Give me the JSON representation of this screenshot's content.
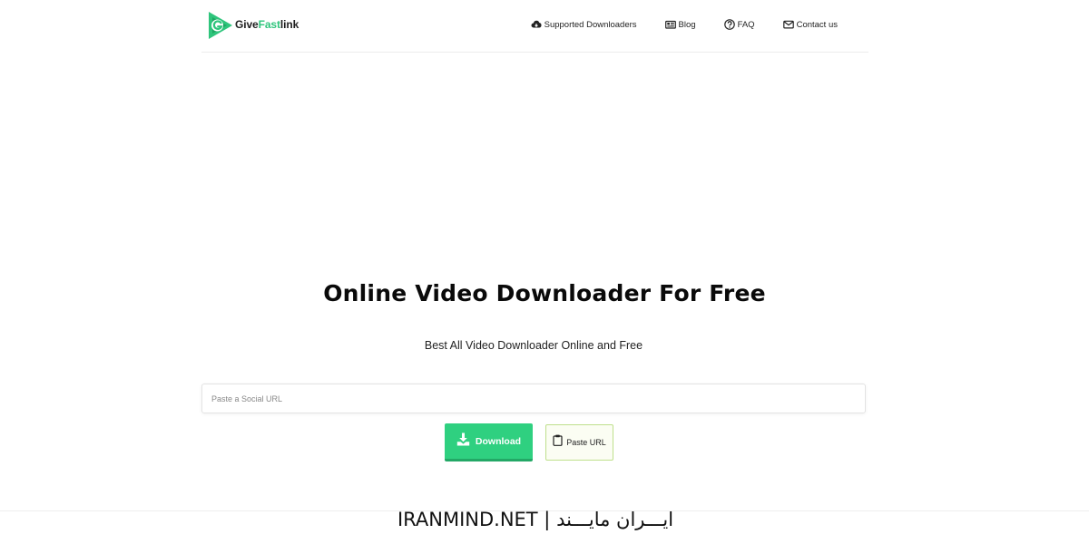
{
  "header": {
    "logo": {
      "give": "Give",
      "fast": "Fast",
      "link": "link"
    },
    "nav": [
      {
        "label": "Supported Downloaders",
        "icon": "cloud-download-icon"
      },
      {
        "label": "Blog",
        "icon": "newspaper-icon"
      },
      {
        "label": "FAQ",
        "icon": "question-circle-icon"
      },
      {
        "label": "Contact us",
        "icon": "envelope-icon"
      }
    ]
  },
  "hero": {
    "title": "Online Video Downloader For Free",
    "subtitle": "Best All Video Downloader Online and Free"
  },
  "form": {
    "url_placeholder": "Paste a Social URL",
    "url_value": "",
    "download_label": "Download",
    "paste_label": "Paste URL"
  },
  "watermark": "IRANMIND.NET | ایـــران مایـــند",
  "colors": {
    "brand_green": "#2fc57c",
    "download_button": "#2fd080",
    "paste_border": "#bfe08c"
  }
}
